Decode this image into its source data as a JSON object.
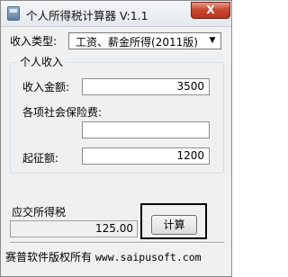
{
  "window": {
    "title": "个人所得税计算器 V:1.1",
    "close_label": "X"
  },
  "income_type": {
    "label": "收入类型:",
    "selected": "工资、薪金所得(2011版)"
  },
  "personal_income": {
    "group_label": "个人收入",
    "income_amount": {
      "label": "收入金额:",
      "value": "3500"
    },
    "social_insurance": {
      "label": "各项社会保险费:",
      "value": ""
    },
    "threshold": {
      "label": "起征额:",
      "value": "1200"
    }
  },
  "tax": {
    "label": "应交所得税",
    "value": "125.00",
    "calculate_label": "计算"
  },
  "footer": {
    "copyright": "赛普软件版权所有",
    "website": "www.saipusoft.com"
  }
}
